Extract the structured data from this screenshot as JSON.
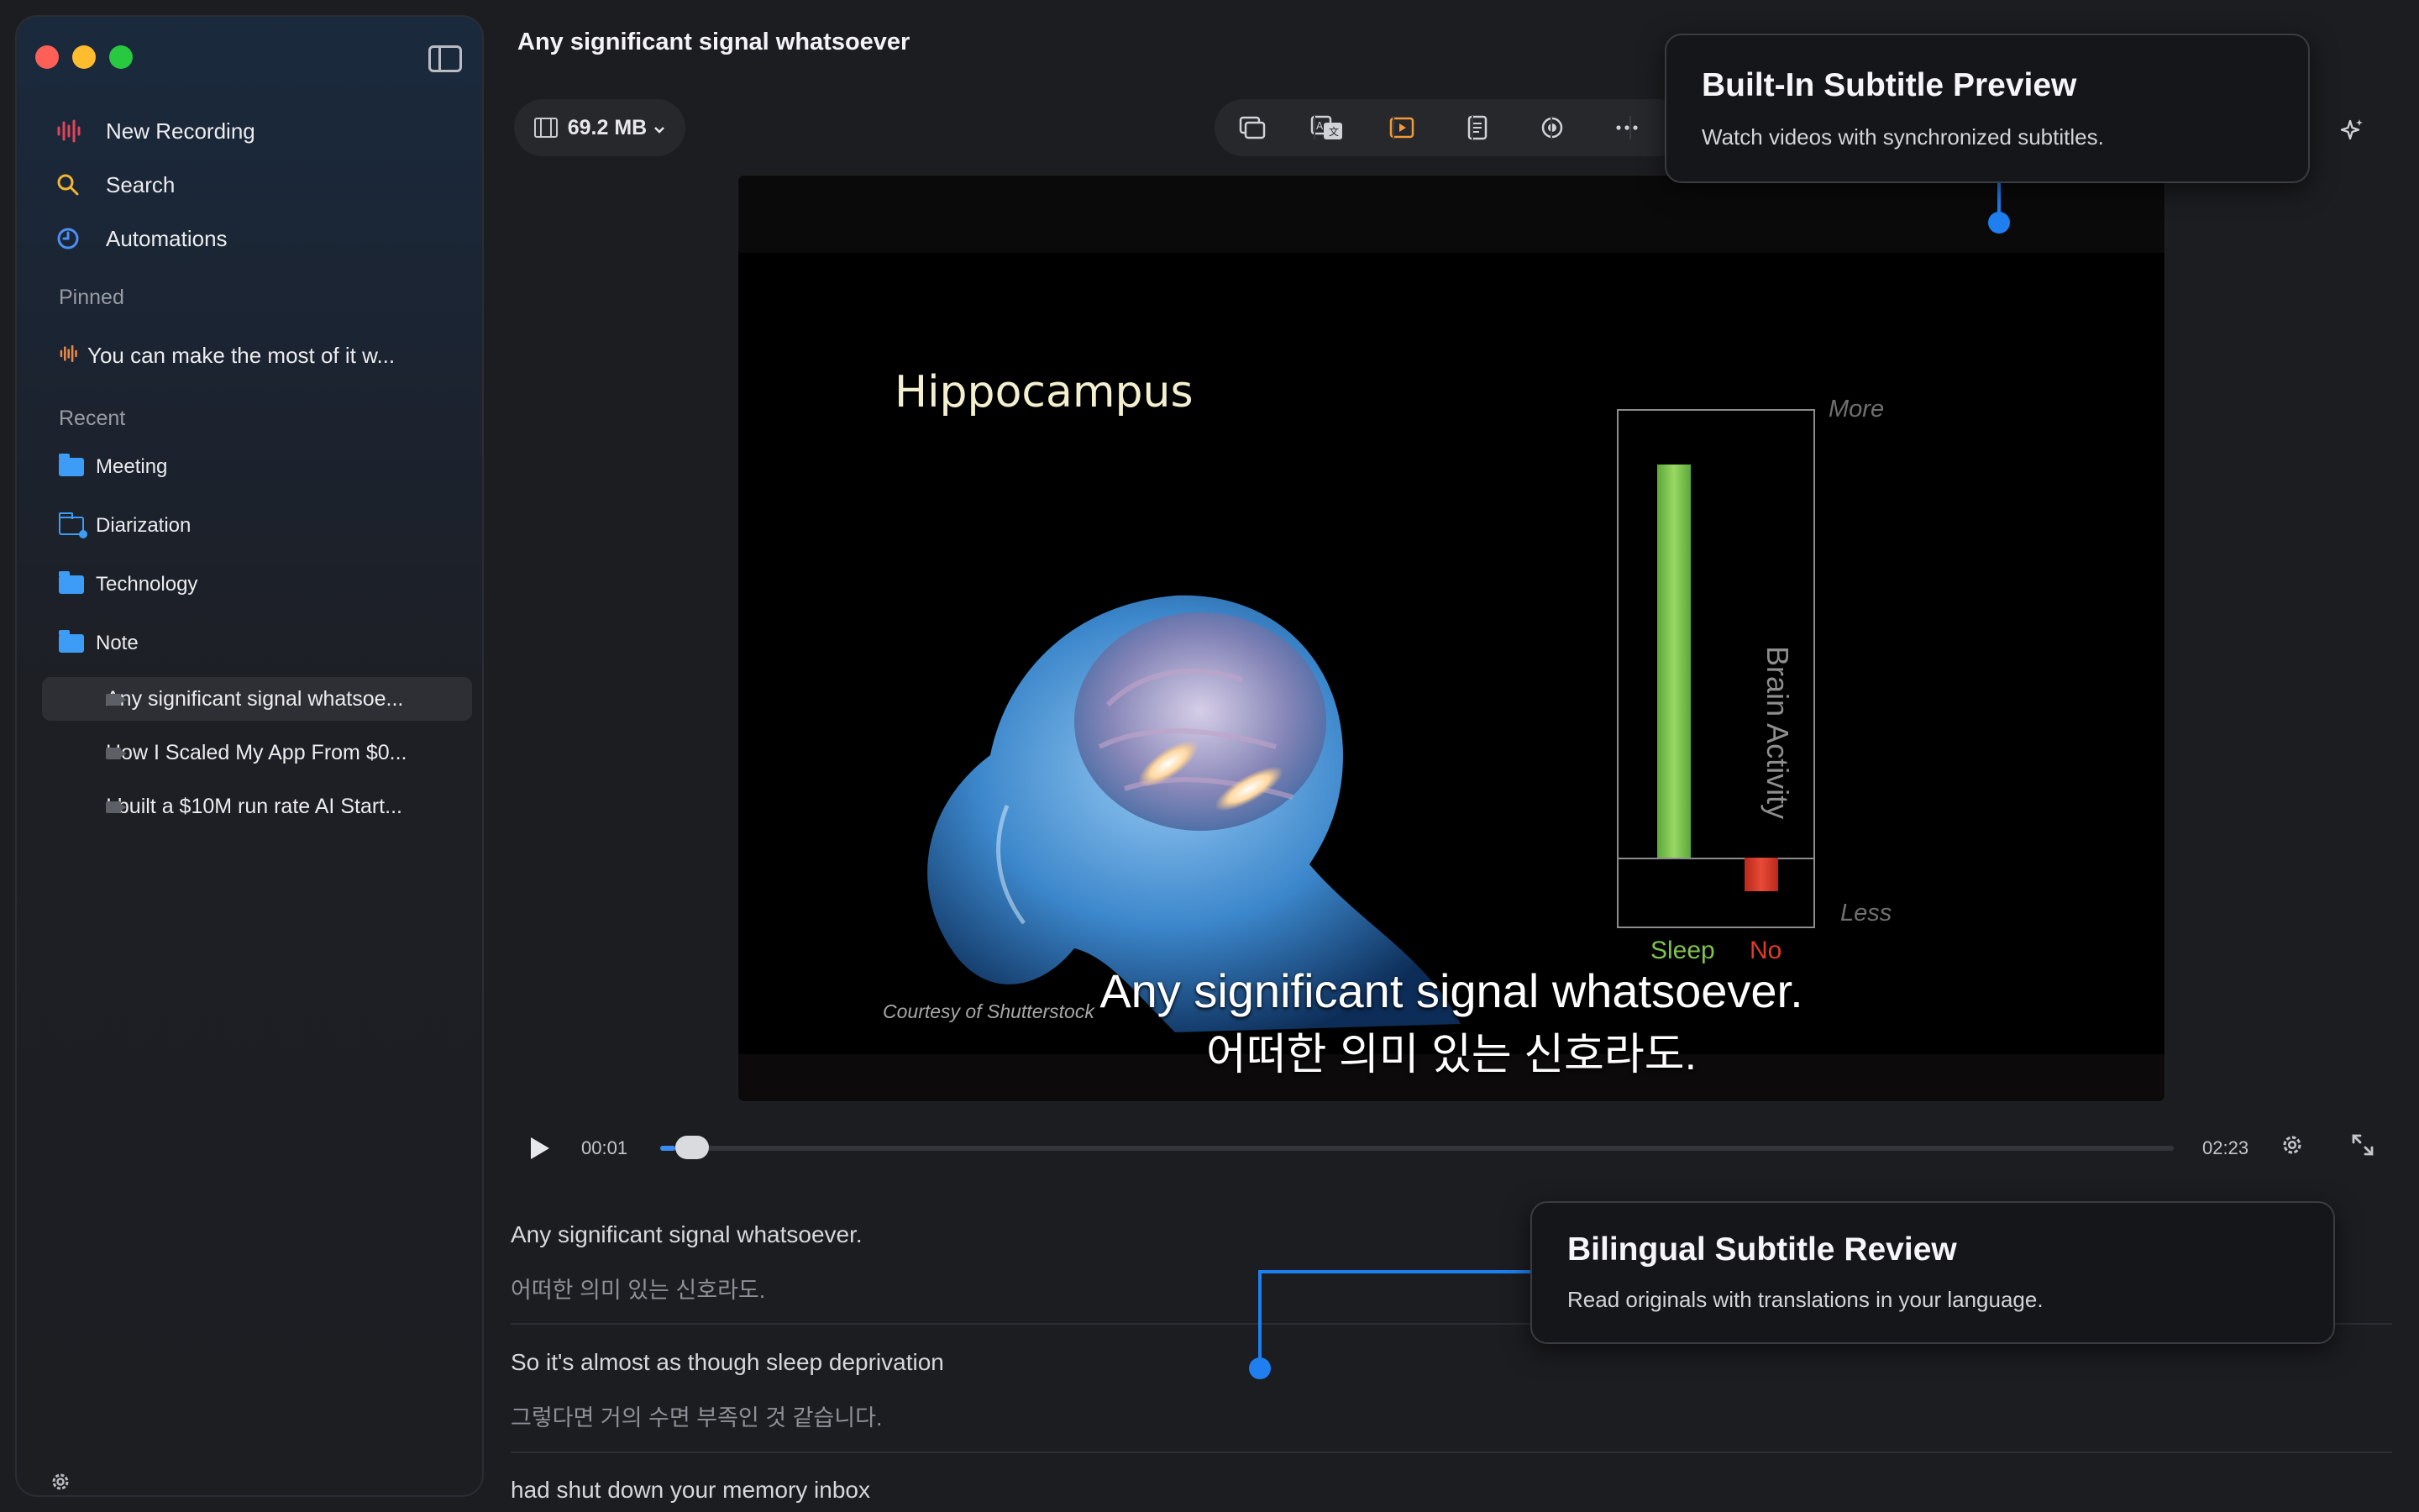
{
  "window": {
    "title": "Any significant signal whatsoever"
  },
  "sidebar": {
    "nav": [
      {
        "label": "New Recording",
        "icon": "waveform-icon"
      },
      {
        "label": "Search",
        "icon": "search-icon"
      },
      {
        "label": "Automations",
        "icon": "clock-icon"
      }
    ],
    "pinned_label": "Pinned",
    "pinned": [
      {
        "label": "You can make the most of it w...",
        "icon": "waveform-icon"
      }
    ],
    "recent_label": "Recent",
    "folders": [
      {
        "label": "Meeting"
      },
      {
        "label": "Diarization"
      },
      {
        "label": "Technology"
      },
      {
        "label": "Note"
      }
    ],
    "videos": [
      {
        "label": "Any significant signal whatsoe...",
        "active": true
      },
      {
        "label": "How I Scaled My App From $0..."
      },
      {
        "label": "I built a $10M run rate AI Start..."
      }
    ]
  },
  "toolbar": {
    "file_size": "69.2 MB",
    "buttons": [
      "multi-window-icon",
      "translate-icon",
      "play-preview-icon",
      "document-icon",
      "record-icon",
      "more-icon"
    ],
    "sparkle_icon": "sparkle-icon"
  },
  "video": {
    "slide_title": "Hippocampus",
    "courtesy": "Courtesy of Shutterstock",
    "chart": {
      "axis_label": "Brain Activity",
      "top_label": "More",
      "bottom_label": "Less",
      "categories": [
        "Sleep",
        "No"
      ]
    },
    "subtitle_en": "Any significant signal whatsoever.",
    "subtitle_ko": "어떠한 의미 있는 신호라도."
  },
  "chart_data": {
    "type": "bar",
    "categories": [
      "Sleep",
      "No"
    ],
    "values": [
      0.9,
      -0.1
    ],
    "ylabel": "Brain Activity",
    "ylim": [
      -0.2,
      1.0
    ],
    "colors": [
      "#7fc24e",
      "#e03a2a"
    ]
  },
  "player": {
    "current_time": "00:01",
    "total_time": "02:23",
    "progress": 0.01
  },
  "transcript": [
    {
      "en": "Any significant signal whatsoever.",
      "ko": "어떠한 의미 있는 신호라도."
    },
    {
      "en": "So it's almost as though sleep deprivation",
      "ko": "그렇다면 거의 수면 부족인 것 같습니다."
    },
    {
      "en": "had shut down your memory inbox",
      "ko": ""
    }
  ],
  "callouts": {
    "subtitle_preview": {
      "title": "Built-In Subtitle Preview",
      "desc": "Watch videos with synchronized subtitles."
    },
    "bilingual_review": {
      "title": "Bilingual Subtitle Review",
      "desc": "Read originals with translations in your language."
    }
  },
  "colors": {
    "accent": "#1f7ff0",
    "folder": "#3d9cf5",
    "record": "#e0455a",
    "pinned": "#e8894a"
  }
}
